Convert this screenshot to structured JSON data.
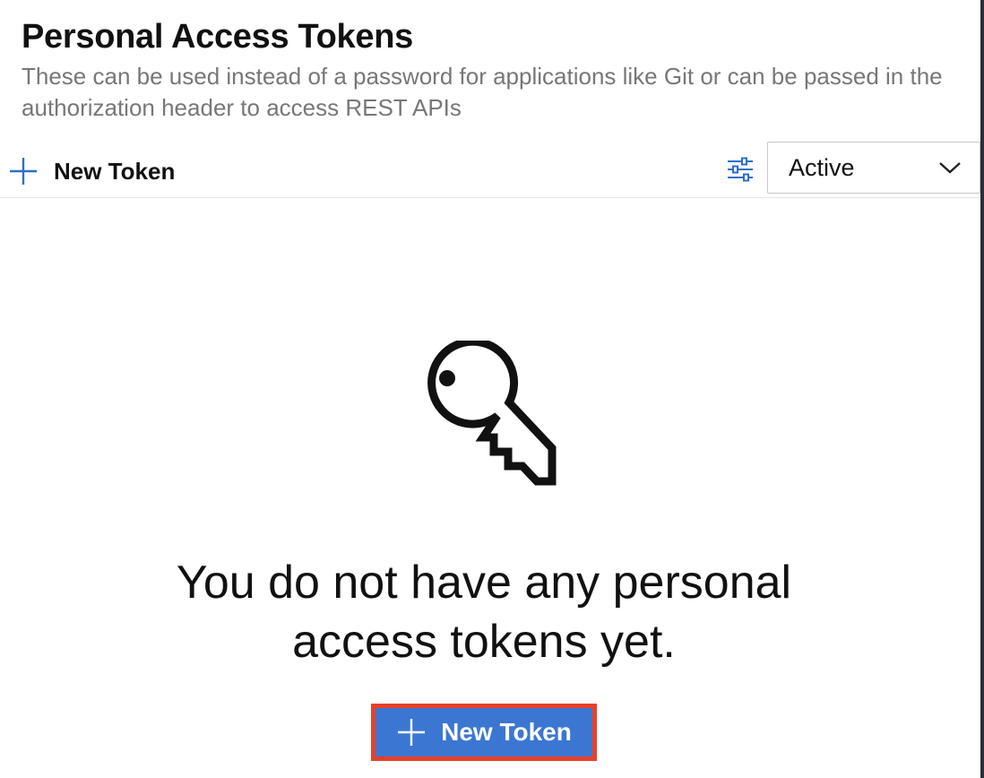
{
  "header": {
    "title": "Personal Access Tokens",
    "subtitle": "These can be used instead of a password for applications like Git or can be passed in the authorization header to access REST APIs"
  },
  "toolbar": {
    "new_token_label": "New Token",
    "new_token_icon": "plus-icon",
    "filter_icon": "filter-sliders-icon",
    "status_dropdown": {
      "selected": "Active",
      "icon": "chevron-down-icon"
    }
  },
  "empty_state": {
    "icon": "key-icon",
    "message": "You do not have any personal access tokens yet.",
    "cta_label": "New Token",
    "cta_icon": "plus-icon"
  },
  "colors": {
    "accent": "#3b77d2",
    "highlight_border": "#e8412b",
    "subtitle_text": "#777777",
    "icon_blue": "#2f6fc9"
  }
}
